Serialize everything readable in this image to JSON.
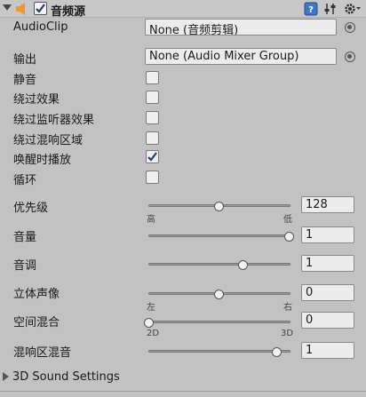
{
  "header": {
    "title": "音频源",
    "enabled": true,
    "help_icon": "help-book-icon",
    "preset_icon": "preset-sliders-icon",
    "settings_icon": "gear-icon"
  },
  "fields": {
    "audioclip_label": "AudioClip",
    "audioclip_value": "None (音频剪辑)",
    "output_label": "输出",
    "output_value": "None (Audio Mixer Group)"
  },
  "toggles": [
    {
      "label": "静音",
      "checked": false
    },
    {
      "label": "绕过效果",
      "checked": false
    },
    {
      "label": "绕过监听器效果",
      "checked": false
    },
    {
      "label": "绕过混响区域",
      "checked": false
    },
    {
      "label": "唤醒时播放",
      "checked": true
    },
    {
      "label": "循环",
      "checked": false
    }
  ],
  "sliders": {
    "priority": {
      "label": "优先级",
      "value": "128",
      "min_label": "高",
      "max_label": "低",
      "fraction": 0.5
    },
    "volume": {
      "label": "音量",
      "value": "1",
      "fraction": 1.0
    },
    "pitch": {
      "label": "音调",
      "value": "1",
      "fraction": 0.67
    },
    "stereo": {
      "label": "立体声像",
      "value": "0",
      "min_label": "左",
      "max_label": "右",
      "fraction": 0.5
    },
    "spatial": {
      "label": "空间混合",
      "value": "0",
      "min_label": "2D",
      "max_label": "3D",
      "fraction": 0.0
    },
    "reverb": {
      "label": "混响区混音",
      "value": "1",
      "fraction": 0.91
    }
  },
  "footer": {
    "section_label": "3D Sound Settings"
  },
  "colors": {
    "background": "#c2c2c2",
    "speaker": "#e89a2c",
    "help_icon": "#3e78c8"
  }
}
